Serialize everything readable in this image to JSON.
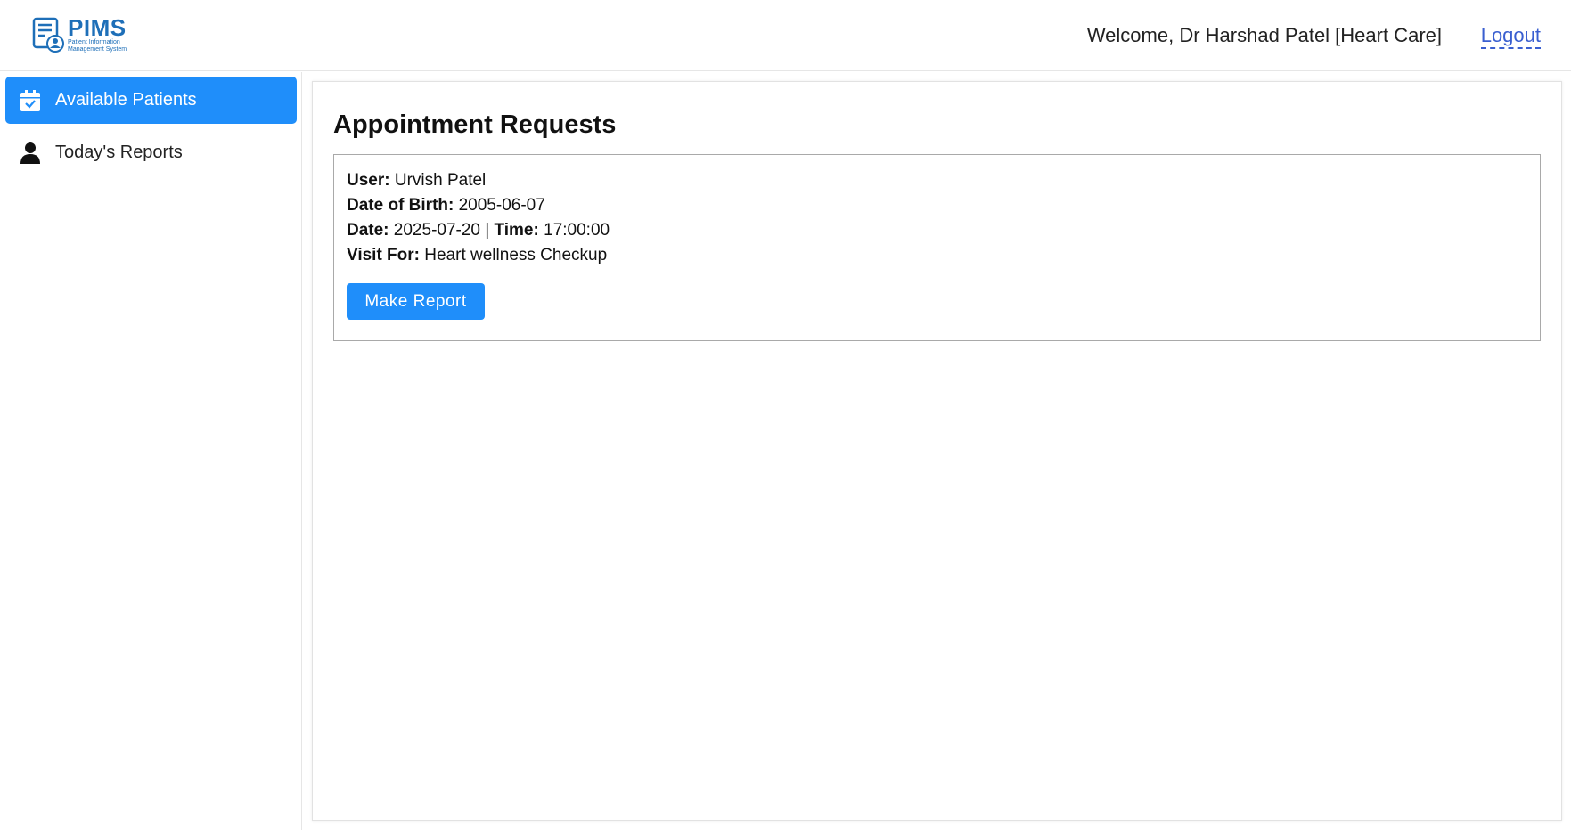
{
  "header": {
    "logo_title": "PIMS",
    "logo_subtitle_line1": "Patient Information",
    "logo_subtitle_line2": "Management System",
    "welcome_text": "Welcome, Dr Harshad Patel [Heart Care]",
    "logout_label": "Logout"
  },
  "sidebar": {
    "items": [
      {
        "label": "Available Patients",
        "icon": "calendar-check-icon",
        "active": true
      },
      {
        "label": "Today's Reports",
        "icon": "person-icon",
        "active": false
      }
    ]
  },
  "main": {
    "title": "Appointment Requests",
    "requests": [
      {
        "user_label": "User:",
        "user": "Urvish Patel",
        "dob_label": "Date of Birth:",
        "dob": "2005-06-07",
        "date_label": "Date:",
        "date": "2025-07-20",
        "separator": "|",
        "time_label": "Time:",
        "time": "17:00:00",
        "visit_label": "Visit For:",
        "visit_for": "Heart wellness Checkup",
        "action_label": "Make Report"
      }
    ]
  },
  "colors": {
    "accent": "#1f8efa",
    "brand": "#1e6fb8",
    "link": "#3a5fd0"
  }
}
